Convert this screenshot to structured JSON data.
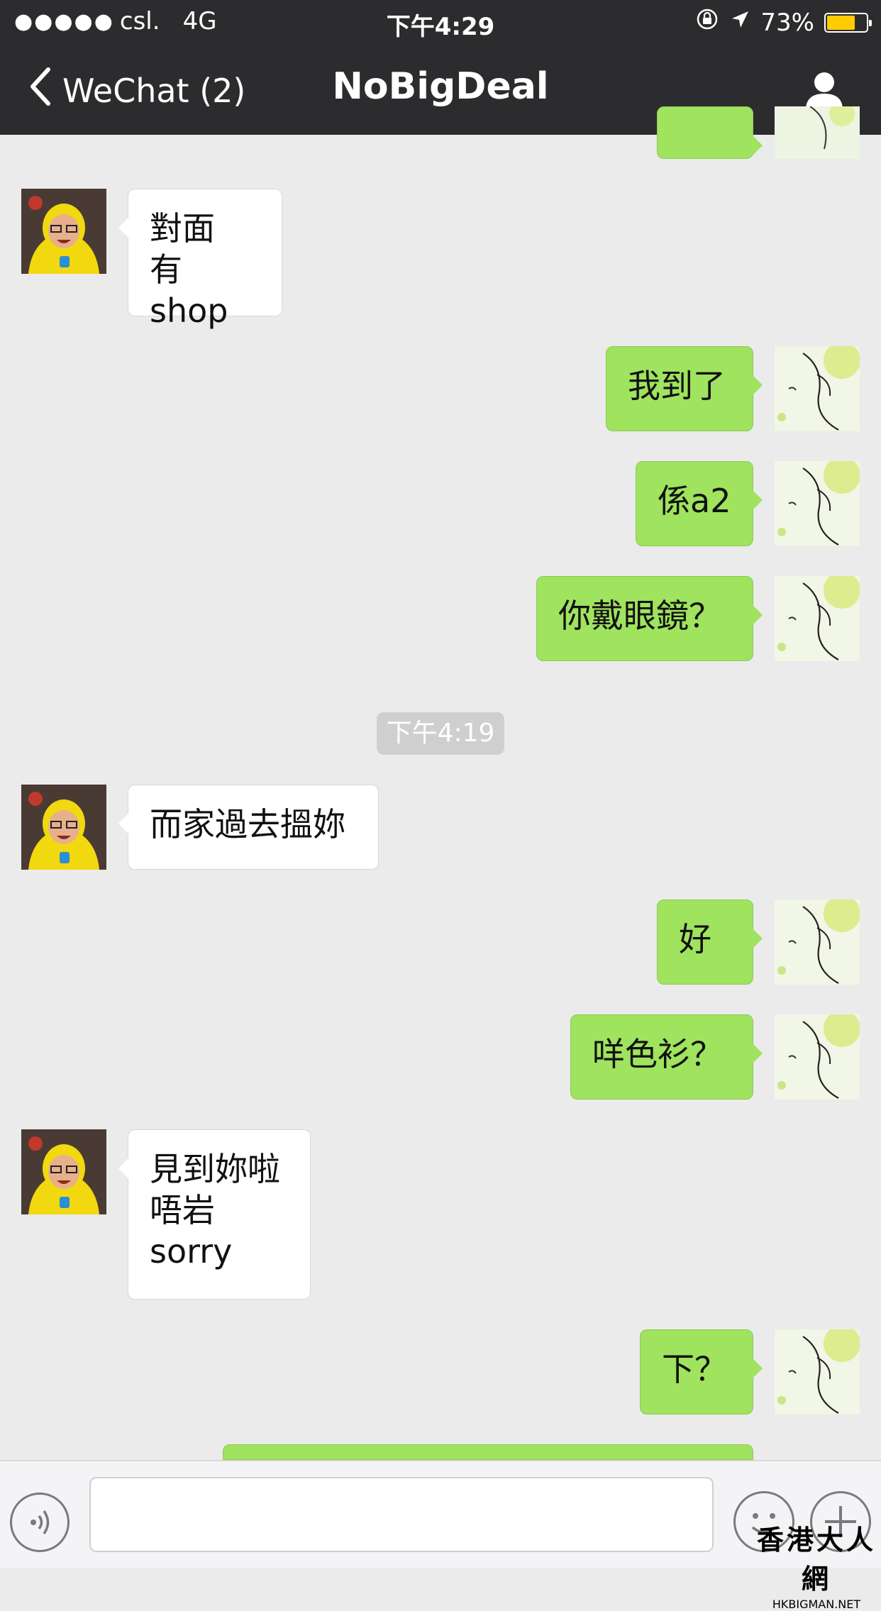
{
  "status_bar": {
    "signal_dots": "●●●●●",
    "carrier": "csl.",
    "network": "4G",
    "time": "下午4:29",
    "battery_percent": "73%",
    "battery_level": 0.73,
    "battery_color": "#ffcc00"
  },
  "nav": {
    "back_label": "WeChat (2)",
    "title": "NoBigDeal"
  },
  "messages": [
    {
      "side": "in",
      "text": "對面\n有shop"
    },
    {
      "side": "out",
      "text": "我到了"
    },
    {
      "side": "out",
      "text": "係a2"
    },
    {
      "side": "out",
      "text": "你戴眼鏡？"
    },
    {
      "side": "in",
      "text": "而家過去搵妳"
    },
    {
      "side": "out",
      "text": "好"
    },
    {
      "side": "out",
      "text": "咩色衫？"
    },
    {
      "side": "in",
      "text": "見到妳啦\n唔岩\nsorry"
    },
    {
      "side": "out",
      "text": "下？"
    }
  ],
  "timestamp_divider": "下午4:19",
  "watermark": {
    "chinese": "香港大人網",
    "english": "HKBIGMAN.NET"
  },
  "colors": {
    "nav_bg": "#2c2c2e",
    "chat_bg": "#ebebeb",
    "outgoing_bubble": "#9fe35e",
    "incoming_bubble": "#ffffff"
  }
}
